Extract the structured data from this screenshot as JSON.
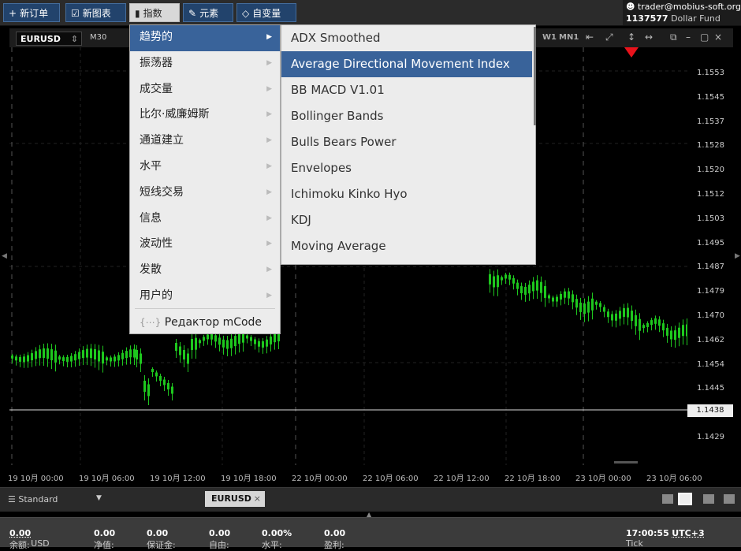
{
  "toolbar": {
    "buttons": [
      {
        "icon": "plus-icon",
        "label": "新订单"
      },
      {
        "icon": "chart-icon",
        "label": "新图表"
      },
      {
        "icon": "bar-chart-icon",
        "label": "指数"
      },
      {
        "icon": "pen-icon",
        "label": "元素"
      },
      {
        "icon": "diamond-icon",
        "label": "自变量"
      }
    ],
    "account_user": "trader@mobius-soft.org",
    "account_number": "1137577",
    "account_fund": "Dollar Fund"
  },
  "chart_header": {
    "symbol": "EURUSD",
    "timeframe": "M30",
    "timeframes": [
      "W1",
      "MN1"
    ]
  },
  "menu": {
    "items": [
      "趋势的",
      "振荡器",
      "成交量",
      "比尔·威廉姆斯",
      "通道建立",
      "水平",
      "短线交易",
      "信息",
      "波动性",
      "发散",
      "用户的"
    ],
    "editor": "Редактор mCode",
    "selected_index": 0
  },
  "submenu": {
    "items": [
      "ADX Smoothed",
      "Average Directional Movement Index",
      "BB MACD V1.01",
      "Bollinger Bands",
      "Bulls Bears Power",
      "Envelopes",
      "Ichimoku Kinko Hyo",
      "KDJ",
      "Moving Average"
    ],
    "selected_index": 1
  },
  "price_axis": {
    "labels": [
      "1.1553",
      "1.1545",
      "1.1537",
      "1.1528",
      "1.1520",
      "1.1512",
      "1.1503",
      "1.1495",
      "1.1487",
      "1.1479",
      "1.1470",
      "1.1462",
      "1.1454",
      "1.1445",
      "1.1438",
      "1.1429"
    ],
    "current_price": "1.1438"
  },
  "time_axis": {
    "labels": [
      "19 10月 00:00",
      "19 10月 06:00",
      "19 10月 12:00",
      "19 10月 18:00",
      "22 10月 00:00",
      "22 10月 06:00",
      "22 10月 12:00",
      "22 10月 18:00",
      "23 10月 00:00",
      "23 10月 06:00"
    ]
  },
  "bottom_tabs": {
    "workspace": "Standard",
    "chart_tab": "EURUSD"
  },
  "status": {
    "balance_label": "余额:",
    "balance": "0.00",
    "currency": "USD",
    "equity_label": "净值:",
    "equity": "0.00",
    "margin_label": "保证金:",
    "margin": "0.00",
    "free_label": "自由:",
    "free": "0.00",
    "level_label": "水平:",
    "level": "0.00%",
    "profit_label": "盈利:",
    "profit": "0.00",
    "tick_label": "Tick",
    "time": "17:00:55",
    "tz": "UTC+3"
  },
  "colors": {
    "bull": "#1ec81e",
    "bear": "#1ec81e",
    "accent": "#39639a"
  }
}
